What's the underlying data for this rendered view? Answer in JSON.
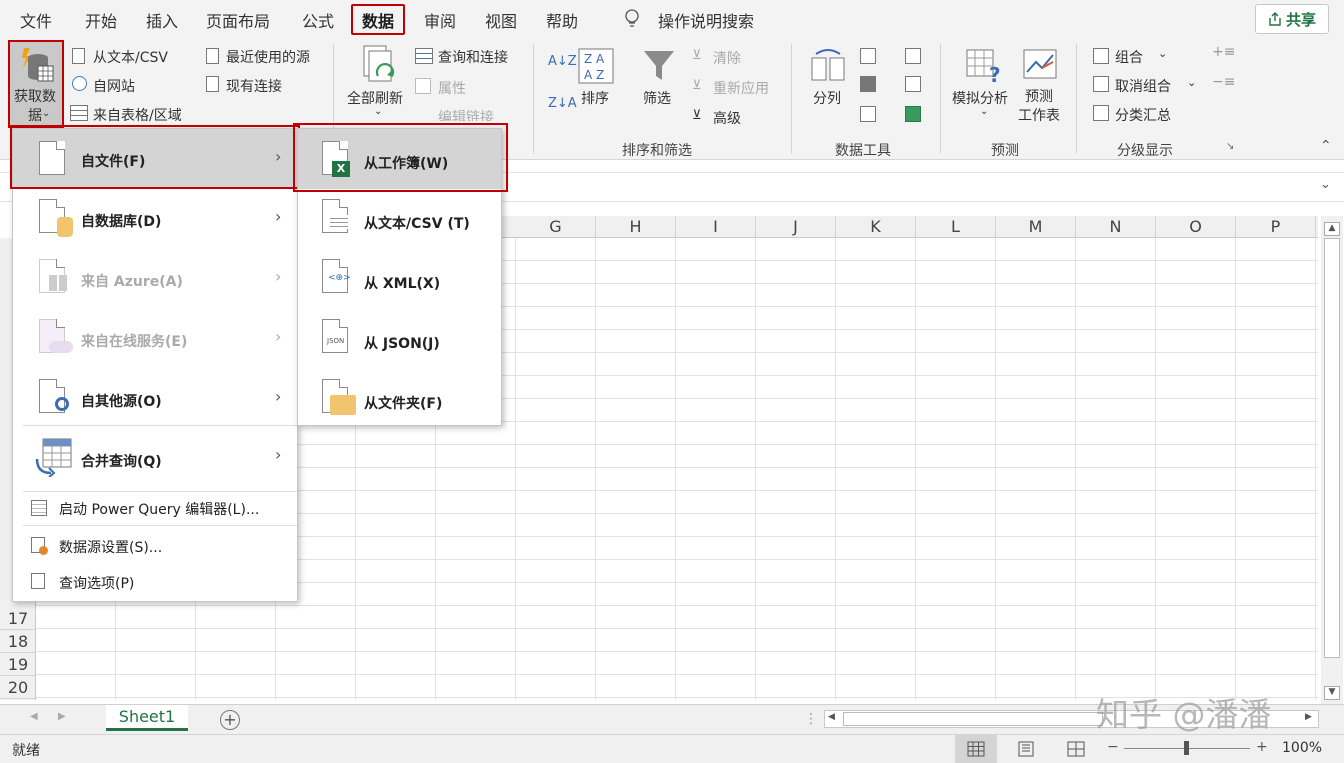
{
  "menu_tabs": [
    "文件",
    "开始",
    "插入",
    "页面布局",
    "公式",
    "数据",
    "审阅",
    "视图",
    "帮助"
  ],
  "tell_me": "操作说明搜索",
  "share": "共享",
  "ribbon": {
    "get_data": "获取数\n据",
    "from_text_csv": "从文本/CSV",
    "from_web": "自网站",
    "from_table": "来自表格/区域",
    "recent_sources": "最近使用的源",
    "existing_conn": "现有连接",
    "refresh_all": "全部刷新",
    "queries_conn": "查询和连接",
    "properties": "属性",
    "edit_links": "编辑链接",
    "sort": "排序",
    "filter": "筛选",
    "clear": "清除",
    "reapply": "重新应用",
    "advanced": "高级",
    "sort_filter_group": "排序和筛选",
    "text_to_cols": "分列",
    "data_tools_group": "数据工具",
    "what_if": "模拟分析",
    "forecast_sheet": "预测\n工作表",
    "forecast_group": "预测",
    "group": "组合",
    "ungroup": "取消组合",
    "subtotal": "分类汇总",
    "outline_group": "分级显示"
  },
  "columns": [
    "G",
    "H",
    "I",
    "J",
    "K",
    "L",
    "M",
    "N",
    "O",
    "P"
  ],
  "rows": [
    "17",
    "18",
    "19",
    "20"
  ],
  "menu1": [
    {
      "label": "自文件(F)",
      "enabled": true
    },
    {
      "label": "自数据库(D)",
      "enabled": true
    },
    {
      "label": "来自 Azure(A)",
      "enabled": false
    },
    {
      "label": "来自在线服务(E)",
      "enabled": false
    },
    {
      "label": "自其他源(O)",
      "enabled": true
    },
    {
      "label": "合并查询(Q)",
      "enabled": true
    }
  ],
  "menu1_bottom": [
    "启动 Power Query 编辑器(L)...",
    "数据源设置(S)...",
    "查询选项(P)"
  ],
  "menu2": [
    "从工作簿(W)",
    "从文本/CSV (T)",
    "从 XML(X)",
    "从 JSON(J)",
    "从文件夹(F)"
  ],
  "sheet_tab": "Sheet1",
  "status": {
    "ready": "就绪",
    "zoom": "100%"
  },
  "watermark": "知乎 @潘潘"
}
